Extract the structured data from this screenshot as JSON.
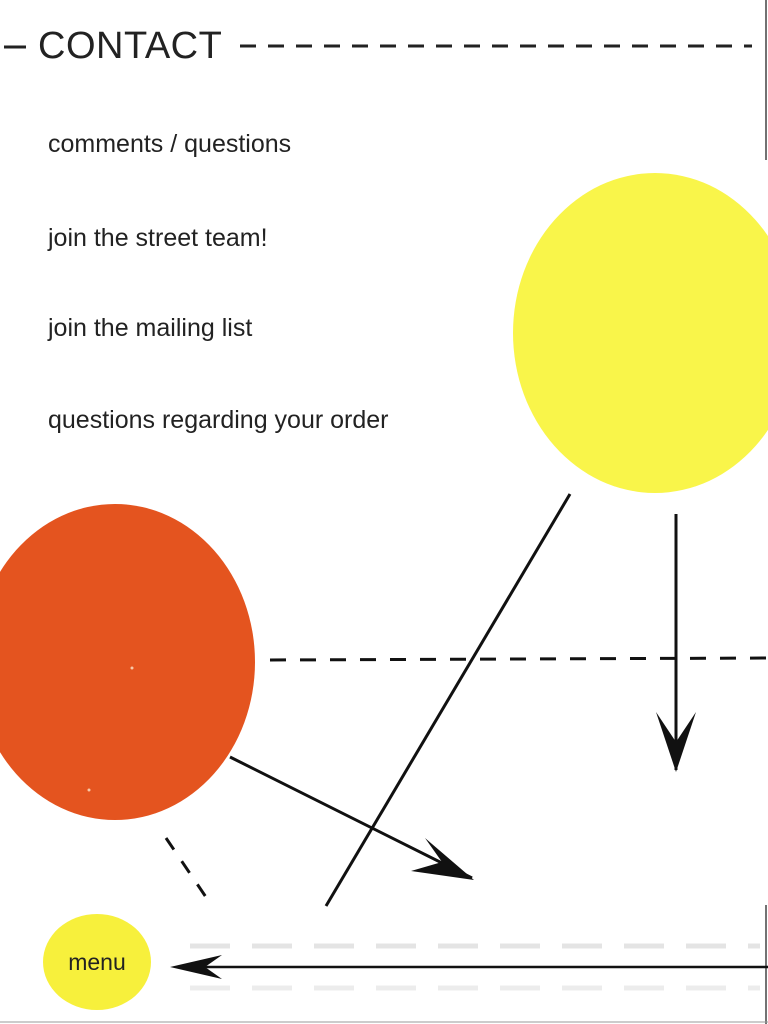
{
  "page": {
    "title": "CONTACT"
  },
  "nav": {
    "items": [
      {
        "label": "comments / questions"
      },
      {
        "label": "join the street team!"
      },
      {
        "label": "join the mailing list"
      },
      {
        "label": "questions regarding your order"
      }
    ]
  },
  "menu": {
    "label": "menu"
  },
  "colors": {
    "yellow": "#f9f54a",
    "orange": "#e4541f",
    "menu_button": "#f7f03c",
    "ink": "#111111"
  }
}
